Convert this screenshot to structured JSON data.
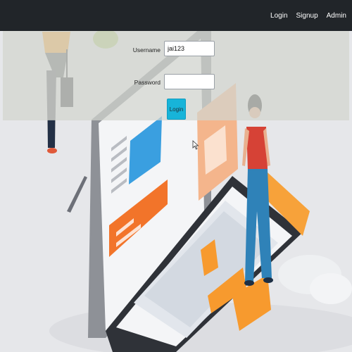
{
  "nav": {
    "links": [
      {
        "label": "Login"
      },
      {
        "label": "Signup"
      },
      {
        "label": "Admin"
      }
    ]
  },
  "form": {
    "username_label": "Username",
    "username_value": "jai123",
    "password_label": "Password",
    "password_value": "",
    "submit_label": "Login"
  },
  "colors": {
    "navbar": "#212529",
    "button": "#17b4d9",
    "accent_orange": "#f79a2e"
  }
}
